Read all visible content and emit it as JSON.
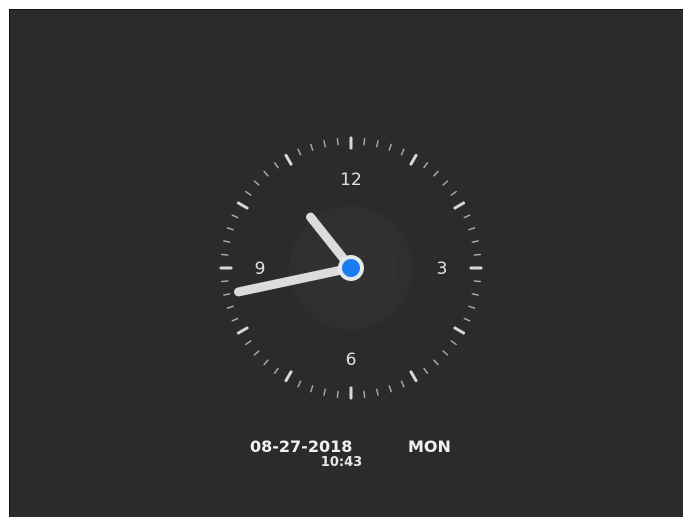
{
  "clock": {
    "numerals": {
      "n12": "12",
      "n3": "3",
      "n6": "6",
      "n9": "9"
    },
    "hands": {
      "hour": 10,
      "minute": 43
    },
    "colors": {
      "background": "#2a2b2d",
      "hands": "#dcdcdc",
      "ticks": "#d8d8d8",
      "center_dot": "#1a7ef0"
    }
  },
  "footer": {
    "date": "08-27-2018",
    "day": "MON",
    "time": "10:43"
  }
}
